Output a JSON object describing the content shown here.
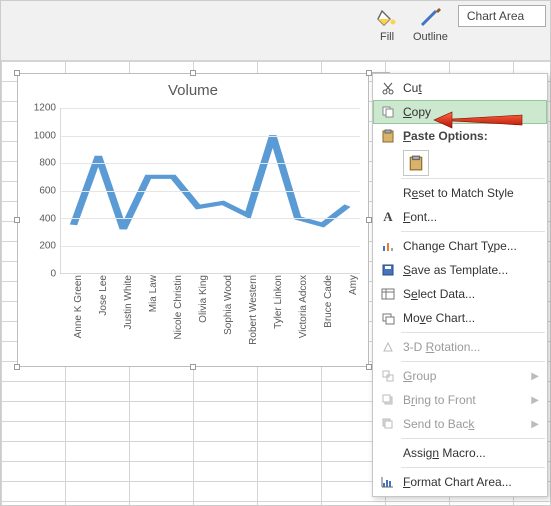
{
  "ribbon": {
    "fill": "Fill",
    "outline": "Outline",
    "chart_area": "Chart Area"
  },
  "chart_data": {
    "type": "line",
    "title": "Volume",
    "xlabel": "",
    "ylabel": "",
    "ylim": [
      0,
      1200
    ],
    "yticks": [
      0,
      200,
      400,
      600,
      800,
      1000,
      1200
    ],
    "categories": [
      "Anne K Green",
      "Jose Lee",
      "Justin White",
      "Mia Law",
      "Nicole Christin",
      "Olivia King",
      "Sophia Wood",
      "Robert Western",
      "Tyler Linkon",
      "Victoria Adcox",
      "Bruce Cade",
      "Amy"
    ],
    "values": [
      350,
      850,
      320,
      700,
      700,
      480,
      510,
      420,
      1000,
      400,
      350,
      490
    ]
  },
  "context_menu": {
    "cut": "Cut",
    "copy": "Copy",
    "paste_options": "Paste Options:",
    "reset": "Reset to Match Style",
    "font": "Font...",
    "change_chart_type": "Change Chart Type...",
    "save_template": "Save as Template...",
    "select_data": "Select Data...",
    "move_chart": "Move Chart...",
    "rotation": "3-D Rotation...",
    "group": "Group",
    "bring_front": "Bring to Front",
    "send_back": "Send to Back",
    "assign_macro": "Assign Macro...",
    "format_chart_area": "Format Chart Area..."
  }
}
